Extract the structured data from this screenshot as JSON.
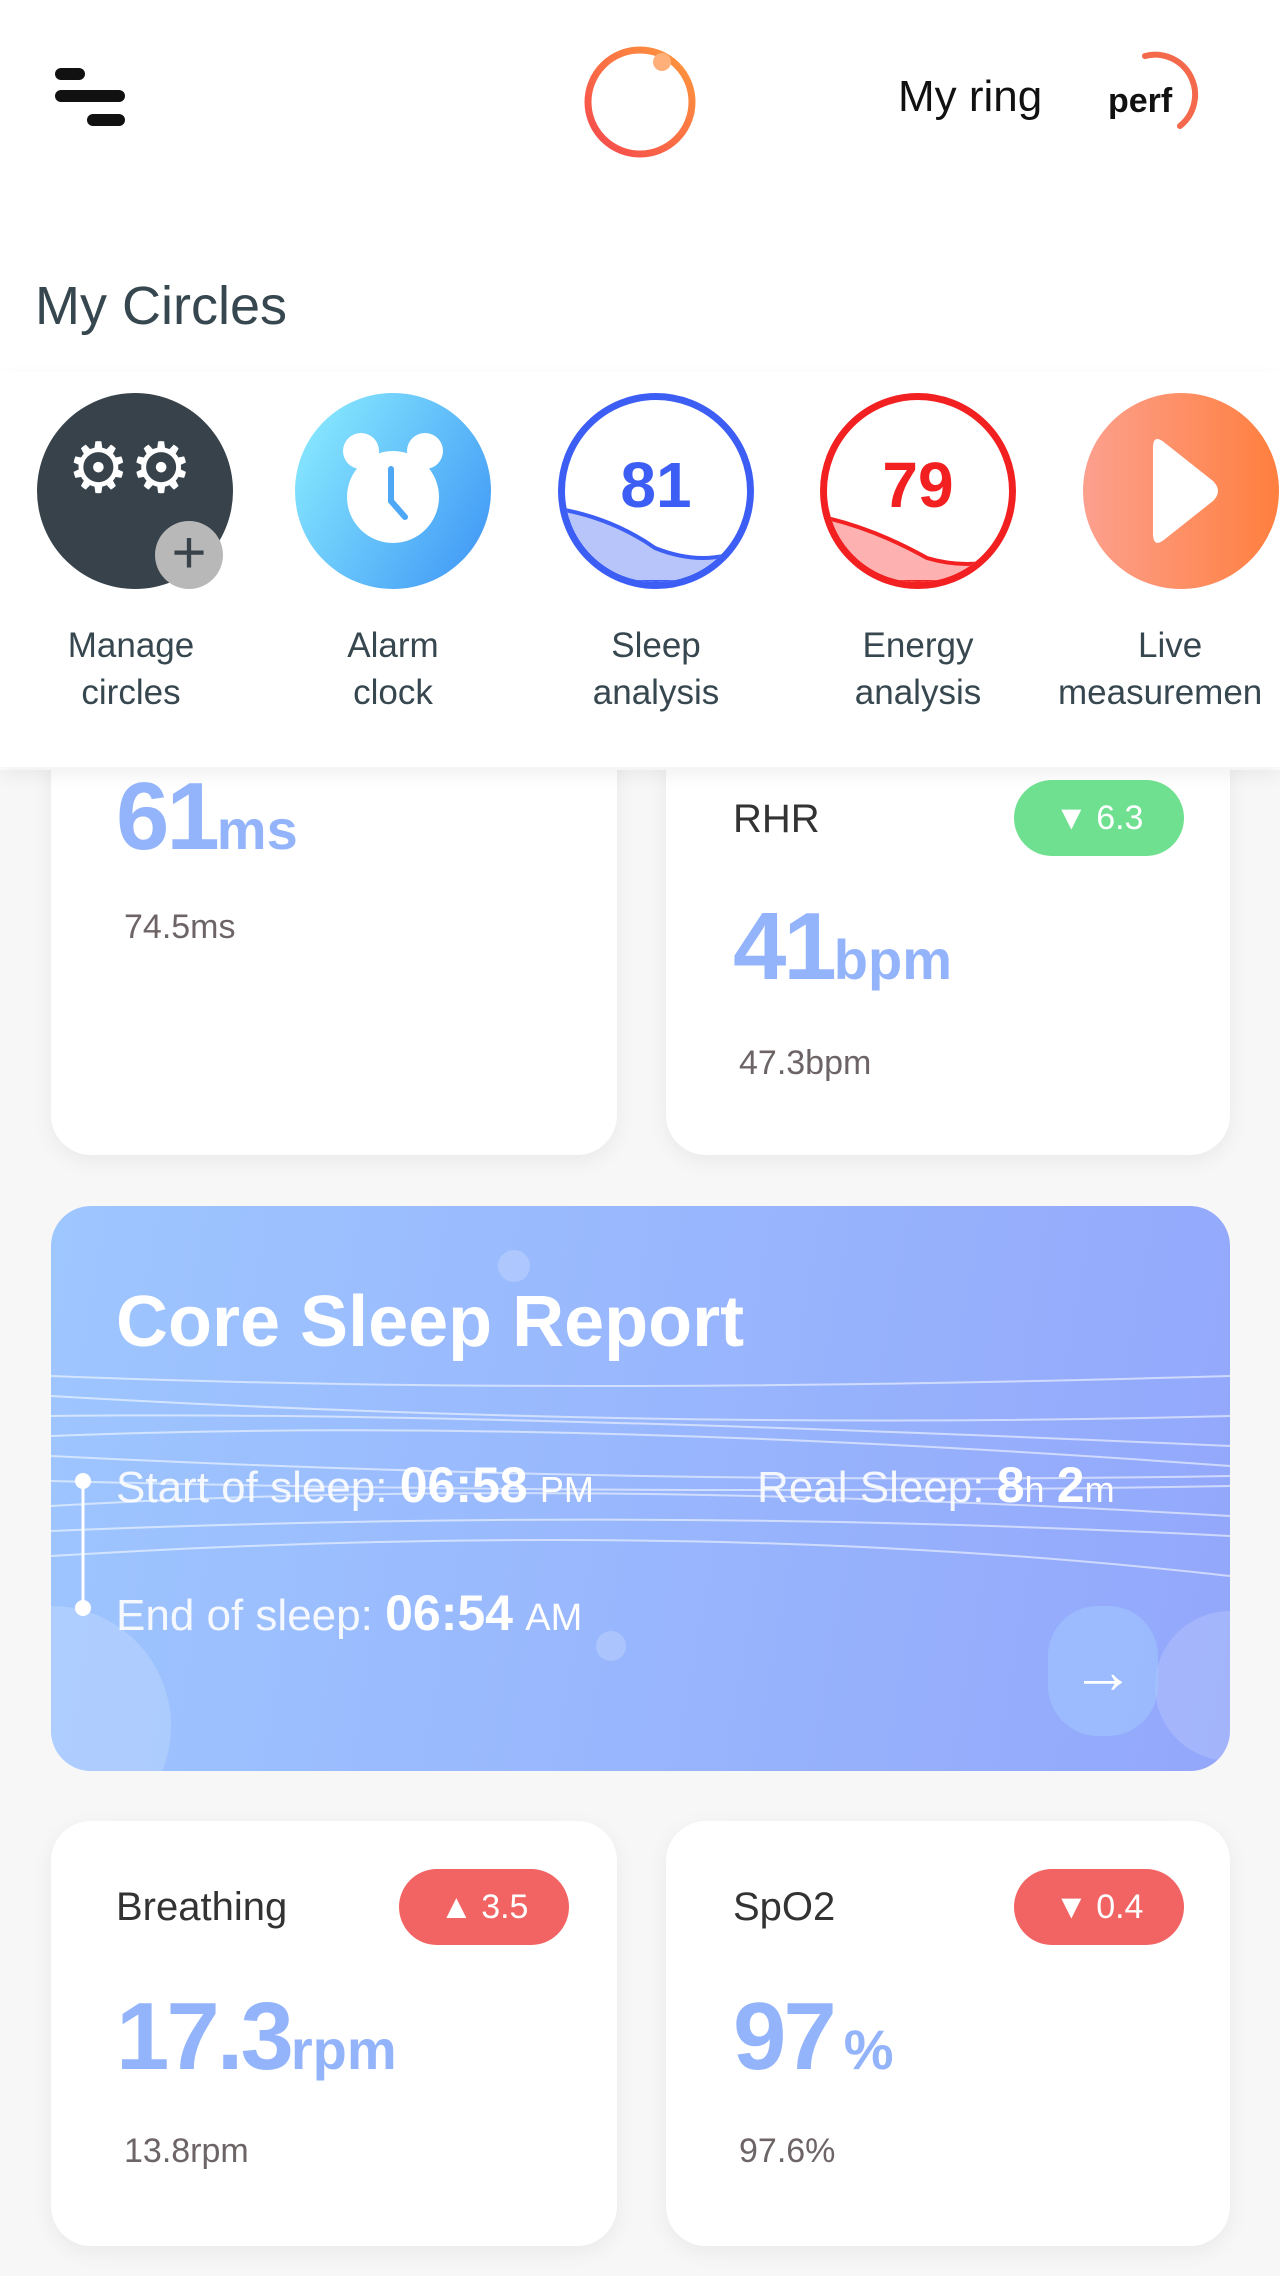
{
  "header": {
    "ring_label": "My ring",
    "ring_brand": "perf"
  },
  "circles": {
    "title": "My Circles",
    "items": [
      {
        "line1": "Manage",
        "line2": "circles"
      },
      {
        "line1": "Alarm",
        "line2": "clock"
      },
      {
        "line1": "Sleep",
        "line2": "analysis",
        "score": "81",
        "color": "#3d5ef5"
      },
      {
        "line1": "Energy",
        "line2": "analysis",
        "score": "79",
        "color": "#f22020"
      },
      {
        "line1": "Live",
        "line2": "measuremen"
      }
    ]
  },
  "hrv": {
    "value": "61",
    "unit": "ms",
    "baseline": "74.5ms"
  },
  "rhr": {
    "label": "RHR",
    "change": "6.3",
    "direction": "down",
    "value": "41",
    "unit": "bpm",
    "baseline": "47.3bpm"
  },
  "sleep_report": {
    "title": "Core Sleep Report",
    "start_label": "Start of sleep:",
    "start_time": "06:58",
    "start_ampm": "PM",
    "real_label": "Real Sleep:",
    "real_h": "8",
    "h": "h",
    "real_m": "2",
    "m": "m",
    "end_label": "End of sleep:",
    "end_time": "06:54",
    "end_ampm": "AM"
  },
  "breathing": {
    "label": "Breathing",
    "change": "3.5",
    "direction": "up",
    "value": "17.3",
    "unit": "rpm",
    "baseline": "13.8rpm"
  },
  "spo2": {
    "label": "SpO2",
    "change": "0.4",
    "direction": "down",
    "value": "97",
    "unit": "%",
    "baseline": "97.6%"
  },
  "colors": {
    "accent": "#ff6b3d",
    "value": "#93b4fb",
    "badge_green": "#6ee08f",
    "badge_red": "#f26363"
  }
}
